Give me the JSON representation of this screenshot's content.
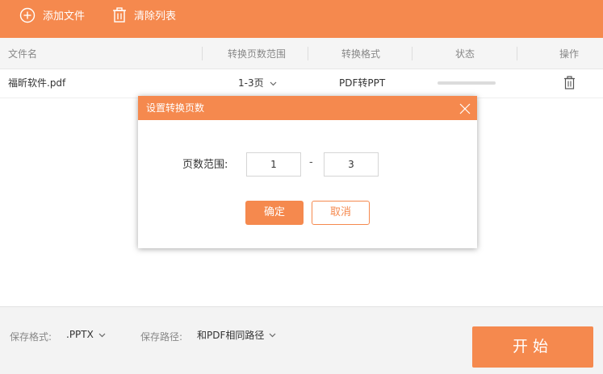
{
  "toolbar": {
    "add_file": {
      "label": "添加文件",
      "icon": "plus-circle-icon"
    },
    "clear_list": {
      "label": "清除列表",
      "icon": "trash-icon"
    }
  },
  "table": {
    "headers": {
      "filename": "文件名",
      "page_range": "转换页数范围",
      "format": "转换格式",
      "status": "状态",
      "action": "操作"
    },
    "rows": [
      {
        "filename": "福昕软件.pdf",
        "page_range": "1-3页",
        "format": "PDF转PPT",
        "progress": 0,
        "action_icon": "trash-icon"
      }
    ]
  },
  "footer": {
    "save_format_label": "保存格式:",
    "save_format_value": ".PPTX",
    "save_path_label": "保存路径:",
    "save_path_value": "和PDF相同路径",
    "start_label": "开始"
  },
  "dialog": {
    "title": "设置转换页数",
    "range_label": "页数范围:",
    "from": "1",
    "separator": "-",
    "to": "3",
    "ok_label": "确定",
    "cancel_label": "取消"
  },
  "colors": {
    "accent": "#F5894E",
    "header_bg": "#F5F5F5",
    "footer_bg": "#F3F3F3"
  }
}
